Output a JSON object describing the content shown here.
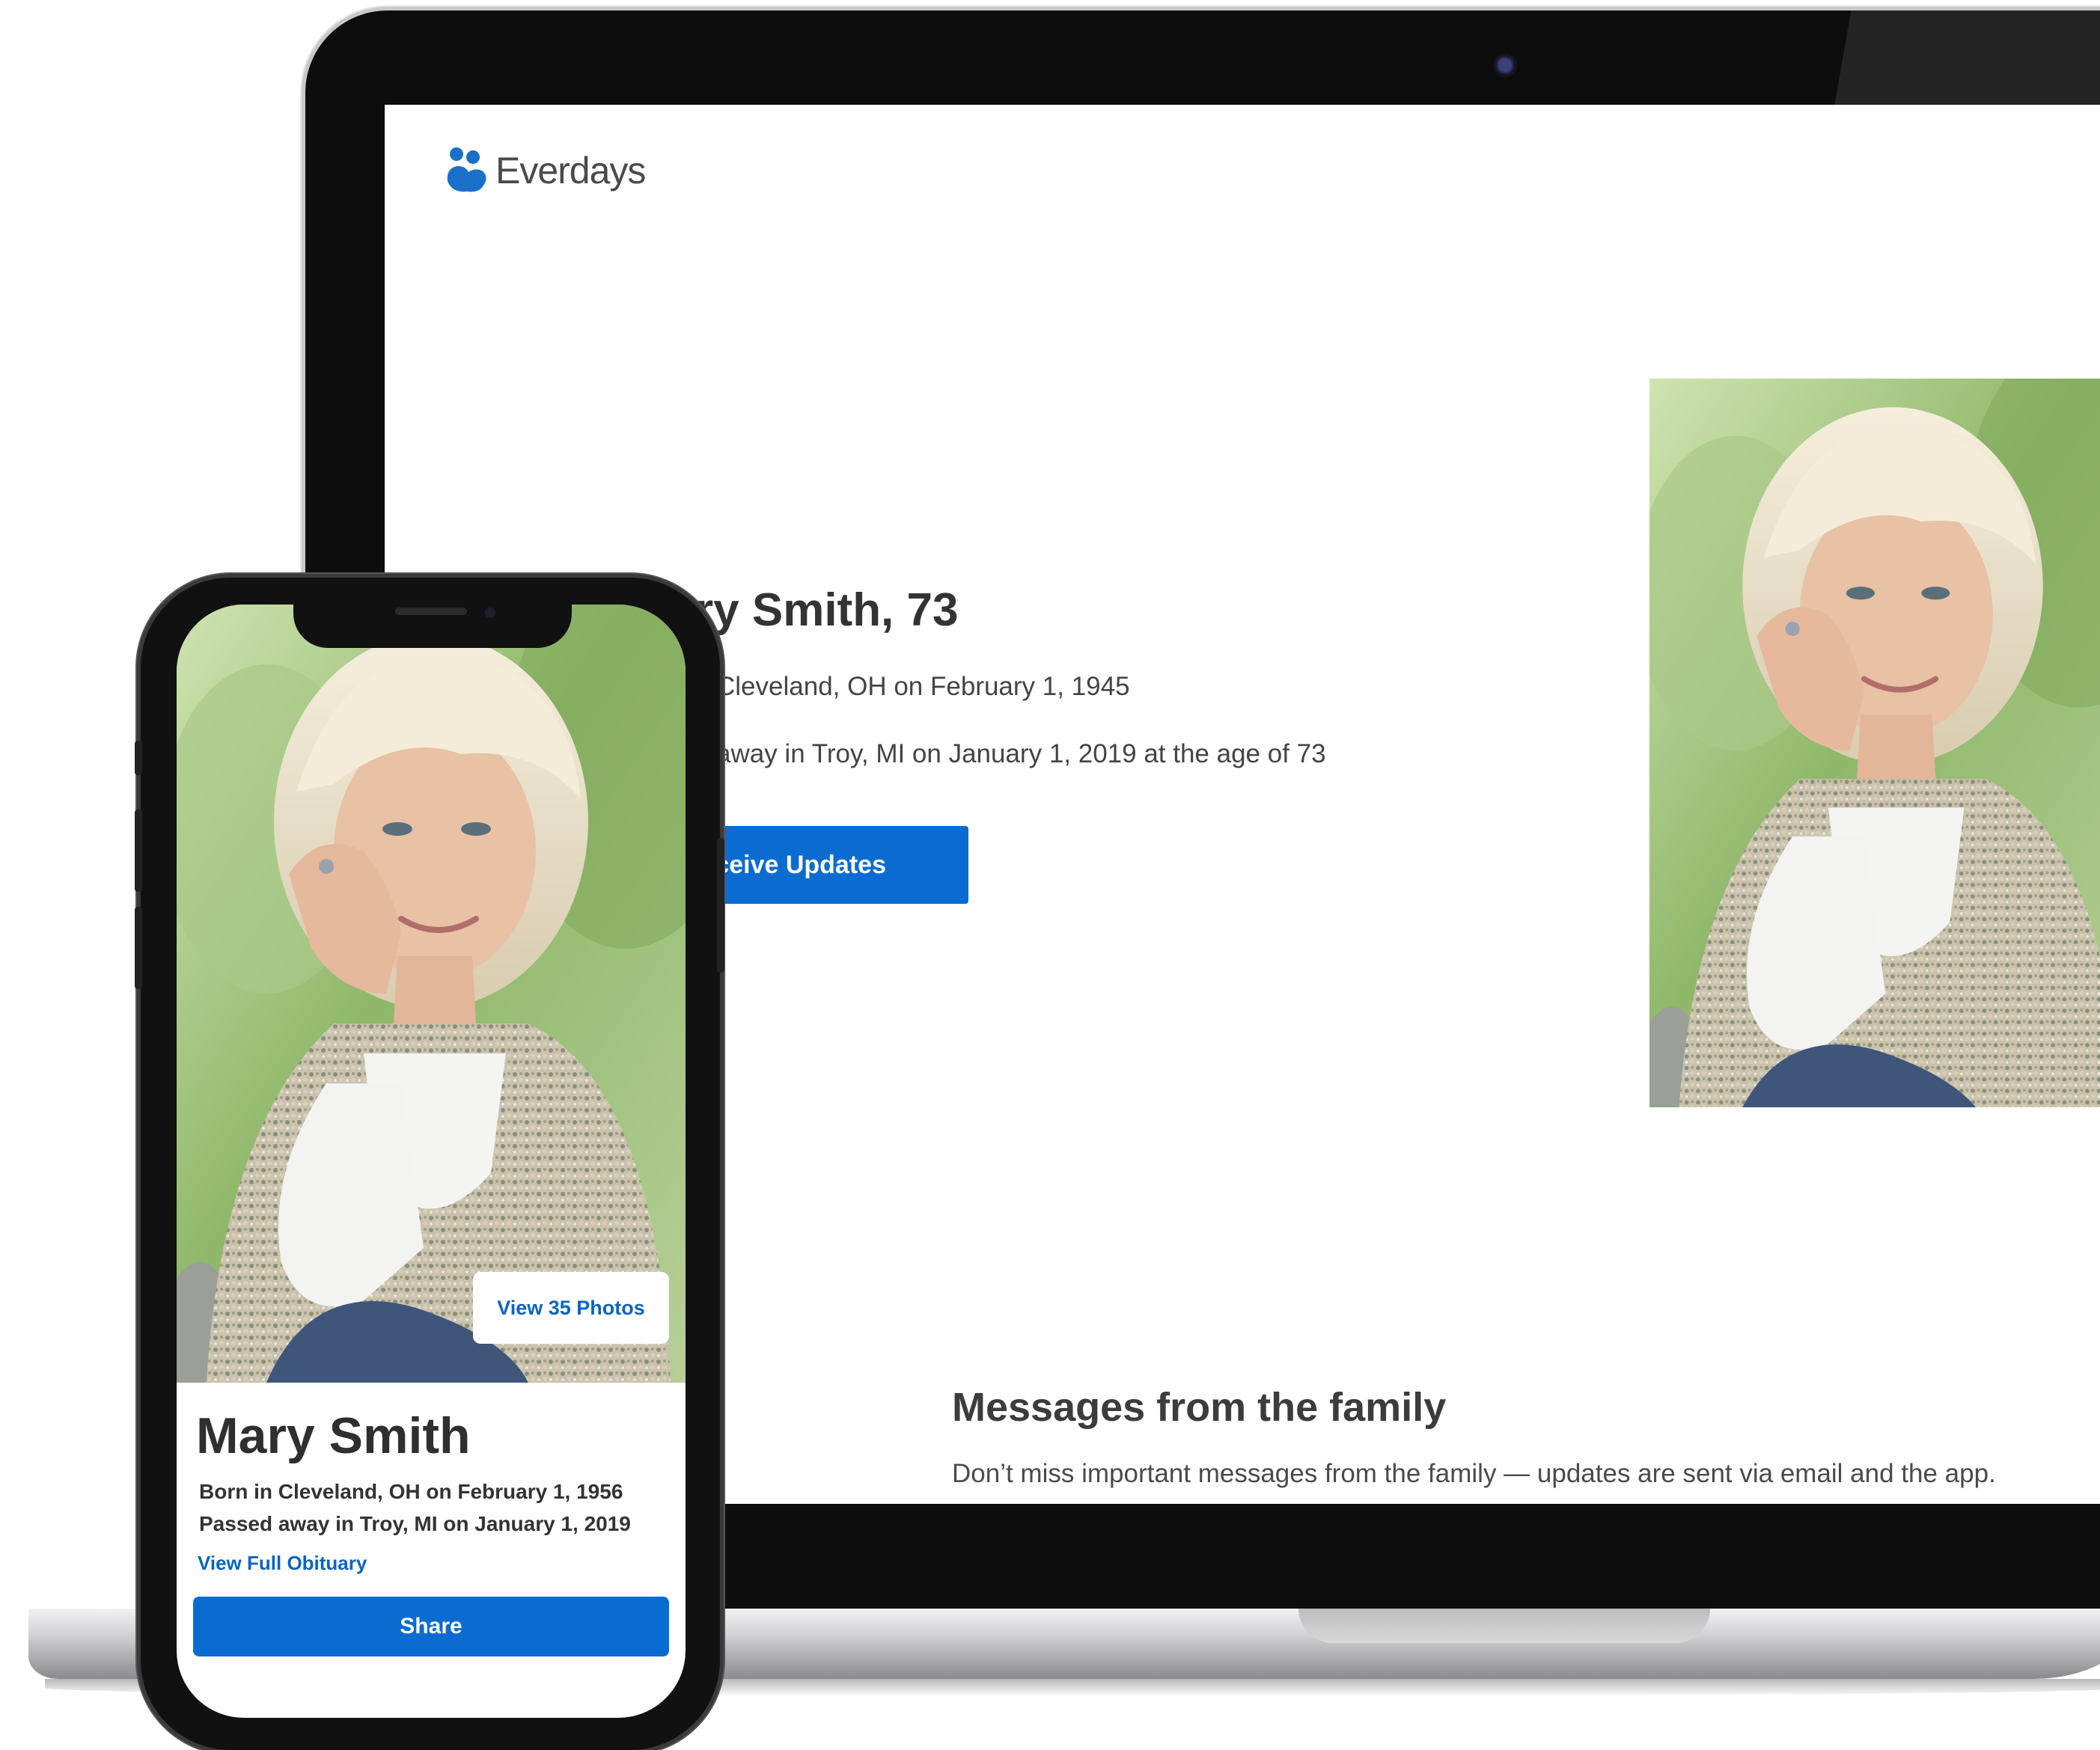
{
  "brand": {
    "name": "Everdays",
    "color": "#1a70c8"
  },
  "desktop": {
    "hero": {
      "name_line": "ry Smith, 73",
      "born_line": "Cleveland, OH on February 1, 1945",
      "passed_line": "away in Troy, MI on January 1, 2019 at the age of 73",
      "receive_button_label": "eceive Updates"
    },
    "messages": {
      "title": "Messages from the family",
      "subtitle": "Don’t miss important messages from the family — updates are sent via email and the app."
    }
  },
  "mobile": {
    "view_photos_label": "View 35 Photos",
    "name": "Mary Smith",
    "born_line": "Born in Cleveland, OH on February 1, 1956",
    "passed_line": "Passed away in Troy, MI on January 1, 2019",
    "obituary_link": "View Full Obituary",
    "share_label": "Share"
  },
  "colors": {
    "accent_blue": "#0a6cd1",
    "link_blue": "#0a64c2",
    "text_dark": "#333333"
  }
}
